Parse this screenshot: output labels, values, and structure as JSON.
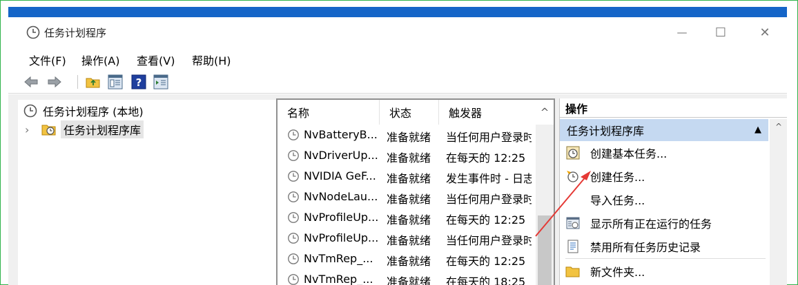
{
  "window": {
    "title": "任务计划程序",
    "controls": {
      "minimize": "—",
      "maximize": "☐",
      "close": "✕"
    }
  },
  "menu": [
    "文件(F)",
    "操作(A)",
    "查看(V)",
    "帮助(H)"
  ],
  "tree": {
    "root": "任务计划程序 (本地)",
    "expander": "›",
    "library": "任务计划程序库"
  },
  "table": {
    "columns": [
      "名称",
      "状态",
      "触发器"
    ],
    "sort_indicator": "^",
    "rows": [
      {
        "name": "NvBatteryB...",
        "status": "准备就绪",
        "trigger": "当任何用户登录时"
      },
      {
        "name": "NvDriverUp...",
        "status": "准备就绪",
        "trigger": "在每天的 12:25"
      },
      {
        "name": "NVIDIA GeF...",
        "status": "准备就绪",
        "trigger": "发生事件时 - 日志"
      },
      {
        "name": "NvNodeLau...",
        "status": "准备就绪",
        "trigger": "当任何用户登录时"
      },
      {
        "name": "NvProfileUp...",
        "status": "准备就绪",
        "trigger": "在每天的 12:25"
      },
      {
        "name": "NvProfileUp...",
        "status": "准备就绪",
        "trigger": "当任何用户登录时"
      },
      {
        "name": "NvTmRep_...",
        "status": "准备就绪",
        "trigger": "在每天的 12:25"
      },
      {
        "name": "NvTmRep_...",
        "status": "准备就绪",
        "trigger": "在每天的 18:25"
      }
    ]
  },
  "actions": {
    "header": "操作",
    "section": "任务计划程序库",
    "items": [
      {
        "label": "创建基本任务...",
        "icon": "create-basic-task-icon"
      },
      {
        "label": "创建任务...",
        "icon": "create-task-icon"
      },
      {
        "label": "导入任务...",
        "icon": ""
      },
      {
        "label": "显示所有正在运行的任务",
        "icon": "running-tasks-icon"
      },
      {
        "label": "禁用所有任务历史记录",
        "icon": "history-icon"
      },
      {
        "label": "新文件夹...",
        "icon": "folder-icon"
      }
    ]
  },
  "colors": {
    "accent": "#1565c8",
    "selection": "#c5d9f1",
    "annotation_arrow": "#e53935"
  }
}
